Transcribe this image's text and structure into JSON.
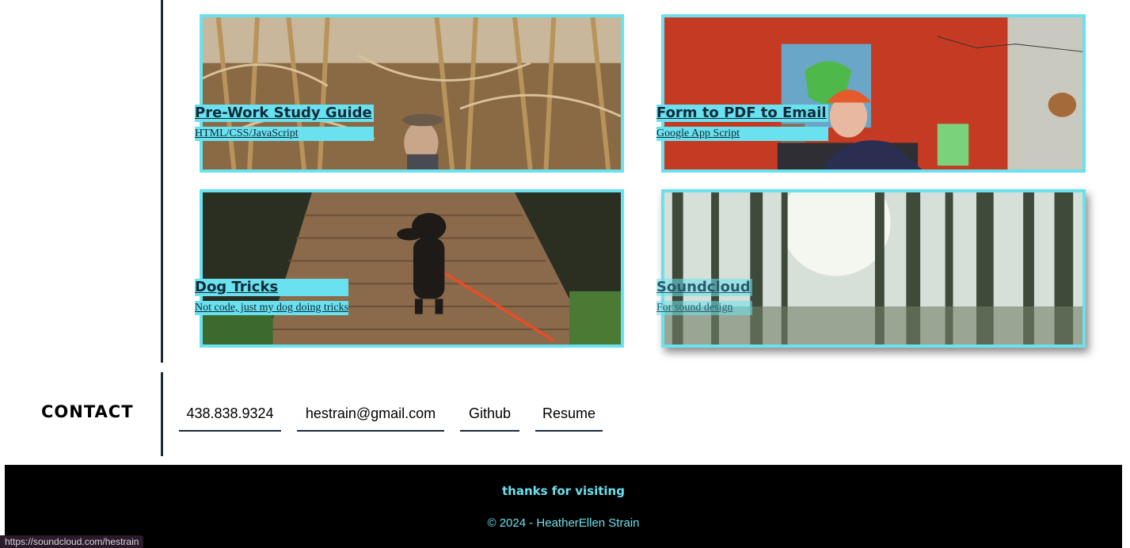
{
  "projects": [
    {
      "title": "Pre-Work Study Guide",
      "subtitle": "HTML/CSS/JavaScript",
      "image": "cornfield-scarecrow-photo"
    },
    {
      "title": "Form to PDF to Email",
      "subtitle": "Google App Script",
      "image": "red-room-selfie-photo"
    },
    {
      "title": "Dog Tricks",
      "subtitle": "Not code, just my dog doing tricks",
      "image": "dachshund-on-boardwalk-photo"
    },
    {
      "title": "Soundcloud",
      "subtitle": "For sound design",
      "image": "pine-forest-photo"
    }
  ],
  "contact": {
    "heading": "CONTACT",
    "phone": "438.838.9324",
    "email": "hestrain@gmail.com",
    "github": "Github",
    "resume": "Resume"
  },
  "footer": {
    "thanks": "thanks for visiting",
    "copyright": "© 2024 - HeatherEllen Strain"
  },
  "status_bar": {
    "url": "https://soundcloud.com/hestrain"
  },
  "colors": {
    "accent": "#6ae1ee",
    "divider": "#1b2a36",
    "footer_bg": "#000000"
  }
}
